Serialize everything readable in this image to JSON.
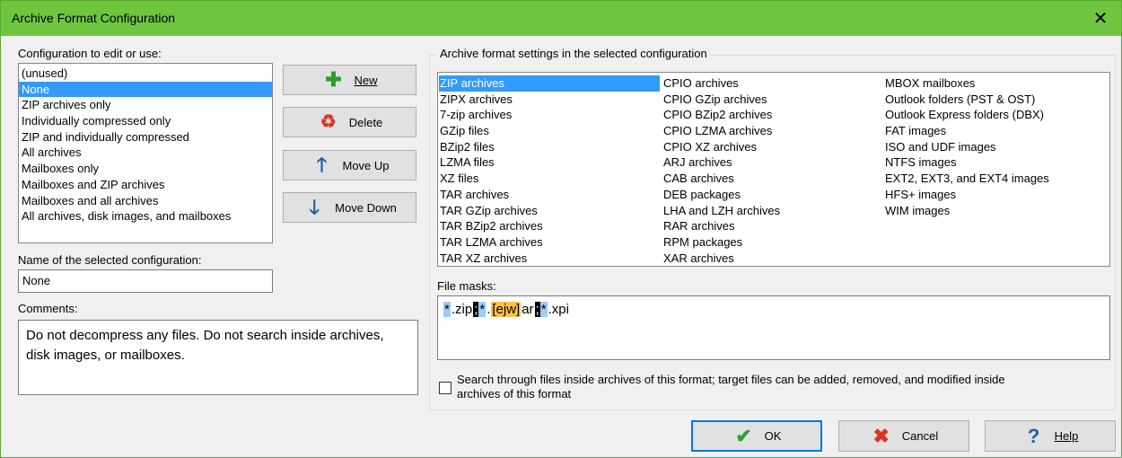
{
  "window": {
    "title": "Archive Format Configuration",
    "close_glyph": "✕"
  },
  "config_list": {
    "label": "Configuration to edit or use:",
    "items": [
      "(unused)",
      "None",
      "ZIP archives only",
      "Individually compressed only",
      "ZIP and individually compressed",
      "All archives",
      "Mailboxes only",
      "Mailboxes and ZIP archives",
      "Mailboxes and all archives",
      "All archives, disk images, and mailboxes"
    ],
    "selected": 1
  },
  "buttons": {
    "new": "New",
    "delete": "Delete",
    "move_up": "Move Up",
    "move_down": "Move Down",
    "ok": "OK",
    "cancel": "Cancel",
    "help": "Help"
  },
  "name_field": {
    "label": "Name of the selected configuration:",
    "value": "None"
  },
  "comments": {
    "label": "Comments:",
    "value": "Do not decompress any files.  Do not search inside archives, disk images, or mailboxes."
  },
  "formats": {
    "label": "Archive format settings in the selected configuration",
    "col1": [
      "ZIP archives",
      "ZIPX archives",
      "7-zip archives",
      "GZip files",
      "BZip2 files",
      "LZMA files",
      "XZ files",
      "TAR archives",
      "TAR GZip archives",
      "TAR BZip2 archives",
      "TAR LZMA archives",
      "TAR XZ archives"
    ],
    "col2": [
      "CPIO archives",
      "CPIO GZip archives",
      "CPIO BZip2 archives",
      "CPIO LZMA archives",
      "CPIO XZ archives",
      "ARJ archives",
      "CAB archives",
      "DEB packages",
      "LHA and LZH archives",
      "RAR archives",
      "RPM packages",
      "XAR archives"
    ],
    "col3": [
      "MBOX mailboxes",
      "Outlook folders (PST & OST)",
      "Outlook Express folders (DBX)",
      "FAT images",
      "ISO and UDF images",
      "NTFS images",
      "EXT2, EXT3, and EXT4 images",
      "HFS+ images",
      "WIM images"
    ],
    "selected": "ZIP archives"
  },
  "file_masks": {
    "label": "File masks:",
    "tokens": [
      {
        "text": "*",
        "style": "blue"
      },
      {
        "text": ".zip",
        "style": "plain"
      },
      {
        "text": ";",
        "style": "dark"
      },
      {
        "text": "*",
        "style": "blue"
      },
      {
        "text": ".",
        "style": "plain"
      },
      {
        "text": "[ejw]",
        "style": "orange"
      },
      {
        "text": "ar",
        "style": "plain"
      },
      {
        "text": ";",
        "style": "dark"
      },
      {
        "text": "*",
        "style": "blue"
      },
      {
        "text": ".xpi",
        "style": "plain"
      }
    ]
  },
  "search_checkbox": {
    "checked": false,
    "line1": "Search through files inside archives of this format; target files can be added, removed, and modified inside",
    "line2": "archives of this format"
  },
  "icons": {
    "new": "plus-icon",
    "delete": "recycle-icon",
    "move_up": "arrow-up-icon",
    "move_down": "arrow-down-icon",
    "ok": "checkmark-icon",
    "cancel": "x-icon",
    "help": "question-icon"
  },
  "colors": {
    "titlebar": "#6ec63f",
    "selection": "#3399ff",
    "mask_highlight_blue": "#99ccff",
    "mask_highlight_orange": "#ffc04d",
    "mask_highlight_dark": "#000000"
  }
}
